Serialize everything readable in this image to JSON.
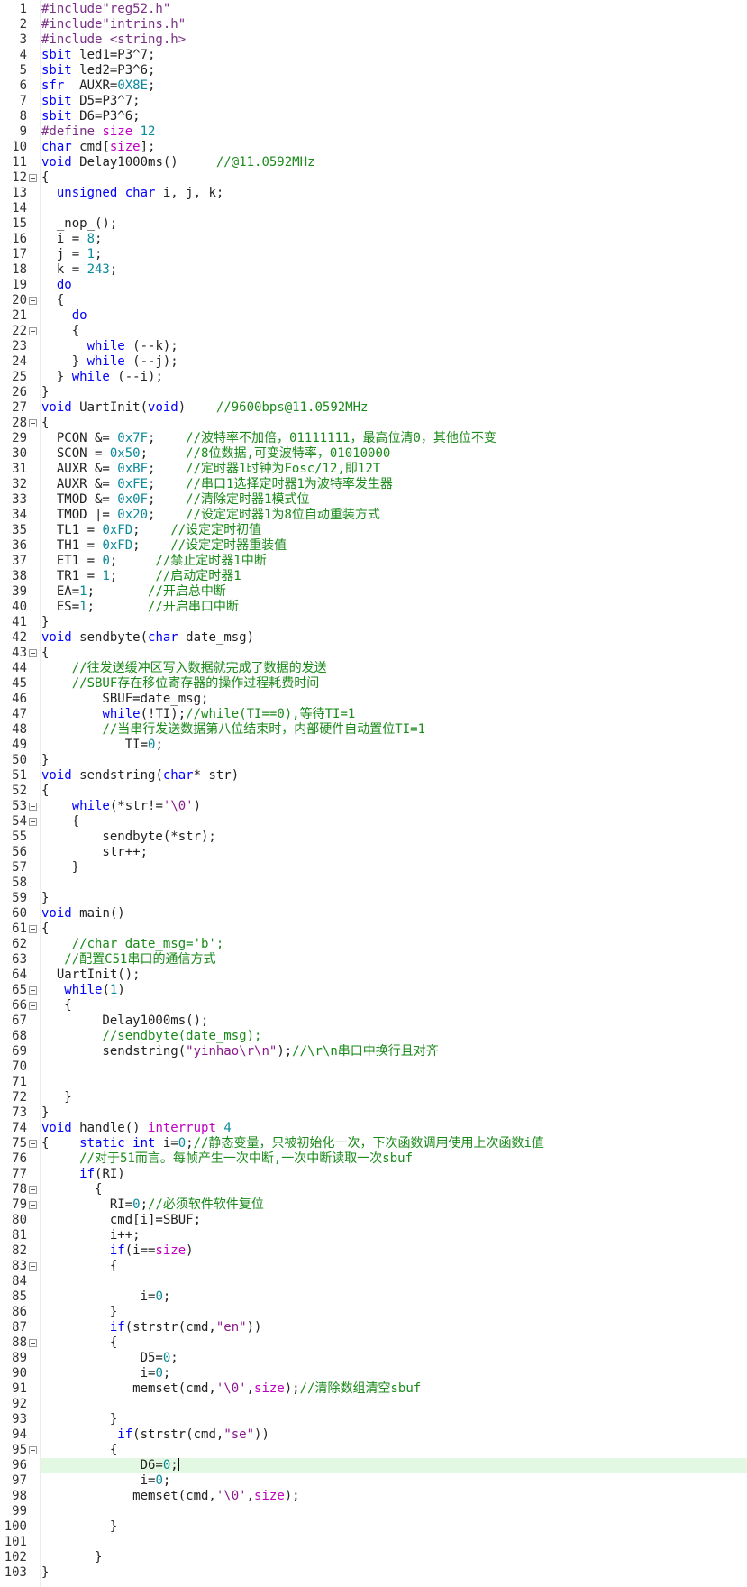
{
  "editor": {
    "current_line": 96,
    "folds": [
      12,
      20,
      22,
      28,
      43,
      53,
      54,
      61,
      65,
      66,
      75,
      78,
      79,
      83,
      88,
      95
    ],
    "lines": [
      [
        [
          "pp",
          "#include\"reg52.h\""
        ]
      ],
      [
        [
          "pp",
          "#include\"intrins.h\""
        ]
      ],
      [
        [
          "pp",
          "#include <string.h>"
        ]
      ],
      [
        [
          "kw",
          "sbit "
        ],
        [
          "id",
          "led1=P3^7;"
        ]
      ],
      [
        [
          "kw",
          "sbit "
        ],
        [
          "id",
          "led2=P3^6;"
        ]
      ],
      [
        [
          "kw",
          "sfr  "
        ],
        [
          "id",
          "AUXR="
        ],
        [
          "num",
          "0X8E"
        ],
        [
          "id",
          ";"
        ]
      ],
      [
        [
          "kw",
          "sbit "
        ],
        [
          "id",
          "D5=P3^7;"
        ]
      ],
      [
        [
          "kw",
          "sbit "
        ],
        [
          "id",
          "D6=P3^6;"
        ]
      ],
      [
        [
          "pp",
          "#define "
        ],
        [
          "ty",
          "size "
        ],
        [
          "num",
          "12"
        ]
      ],
      [
        [
          "kw",
          "char "
        ],
        [
          "id",
          "cmd["
        ],
        [
          "ty",
          "size"
        ],
        [
          "id",
          "];"
        ]
      ],
      [
        [
          "kw",
          "void "
        ],
        [
          "id",
          "Delay1000ms()     "
        ],
        [
          "cm",
          "//@11.0592MHz"
        ]
      ],
      [
        [
          "id",
          "{"
        ]
      ],
      [
        [
          "id",
          "  "
        ],
        [
          "kw",
          "unsigned char "
        ],
        [
          "id",
          "i, j, k;"
        ]
      ],
      [
        [
          "id",
          ""
        ]
      ],
      [
        [
          "id",
          "  _nop_();"
        ]
      ],
      [
        [
          "id",
          "  i = "
        ],
        [
          "num",
          "8"
        ],
        [
          "id",
          ";"
        ]
      ],
      [
        [
          "id",
          "  j = "
        ],
        [
          "num",
          "1"
        ],
        [
          "id",
          ";"
        ]
      ],
      [
        [
          "id",
          "  k = "
        ],
        [
          "num",
          "243"
        ],
        [
          "id",
          ";"
        ]
      ],
      [
        [
          "id",
          "  "
        ],
        [
          "kw",
          "do"
        ]
      ],
      [
        [
          "id",
          "  {"
        ]
      ],
      [
        [
          "id",
          "    "
        ],
        [
          "kw",
          "do"
        ]
      ],
      [
        [
          "id",
          "    {"
        ]
      ],
      [
        [
          "id",
          "      "
        ],
        [
          "kw",
          "while "
        ],
        [
          "id",
          "(--k);"
        ]
      ],
      [
        [
          "id",
          "    } "
        ],
        [
          "kw",
          "while "
        ],
        [
          "id",
          "(--j);"
        ]
      ],
      [
        [
          "id",
          "  } "
        ],
        [
          "kw",
          "while "
        ],
        [
          "id",
          "(--i);"
        ]
      ],
      [
        [
          "id",
          "}"
        ]
      ],
      [
        [
          "kw",
          "void "
        ],
        [
          "id",
          "UartInit("
        ],
        [
          "kw",
          "void"
        ],
        [
          "id",
          ")    "
        ],
        [
          "cm",
          "//9600bps@11.0592MHz"
        ]
      ],
      [
        [
          "id",
          "{"
        ]
      ],
      [
        [
          "id",
          "  PCON &= "
        ],
        [
          "num",
          "0x7F"
        ],
        [
          "id",
          ";    "
        ],
        [
          "cm",
          "//波特率不加倍，01111111，最高位清0，其他位不变"
        ]
      ],
      [
        [
          "id",
          "  SCON = "
        ],
        [
          "num",
          "0x50"
        ],
        [
          "id",
          ";     "
        ],
        [
          "cm",
          "//8位数据,可变波特率，01010000"
        ]
      ],
      [
        [
          "id",
          "  AUXR &= "
        ],
        [
          "num",
          "0xBF"
        ],
        [
          "id",
          ";    "
        ],
        [
          "cm",
          "//定时器1时钟为Fosc/12,即12T"
        ]
      ],
      [
        [
          "id",
          "  AUXR &= "
        ],
        [
          "num",
          "0xFE"
        ],
        [
          "id",
          ";    "
        ],
        [
          "cm",
          "//串口1选择定时器1为波特率发生器"
        ]
      ],
      [
        [
          "id",
          "  TMOD &= "
        ],
        [
          "num",
          "0x0F"
        ],
        [
          "id",
          ";    "
        ],
        [
          "cm",
          "//清除定时器1模式位"
        ]
      ],
      [
        [
          "id",
          "  TMOD |= "
        ],
        [
          "num",
          "0x20"
        ],
        [
          "id",
          ";    "
        ],
        [
          "cm",
          "//设定定时器1为8位自动重装方式"
        ]
      ],
      [
        [
          "id",
          "  TL1 = "
        ],
        [
          "num",
          "0xFD"
        ],
        [
          "id",
          ";    "
        ],
        [
          "cm",
          "//设定定时初值"
        ]
      ],
      [
        [
          "id",
          "  TH1 = "
        ],
        [
          "num",
          "0xFD"
        ],
        [
          "id",
          ";    "
        ],
        [
          "cm",
          "//设定定时器重装值"
        ]
      ],
      [
        [
          "id",
          "  ET1 = "
        ],
        [
          "num",
          "0"
        ],
        [
          "id",
          ";     "
        ],
        [
          "cm",
          "//禁止定时器1中断"
        ]
      ],
      [
        [
          "id",
          "  TR1 = "
        ],
        [
          "num",
          "1"
        ],
        [
          "id",
          ";     "
        ],
        [
          "cm",
          "//启动定时器1"
        ]
      ],
      [
        [
          "id",
          "  EA="
        ],
        [
          "num",
          "1"
        ],
        [
          "id",
          ";       "
        ],
        [
          "cm",
          "//开启总中断"
        ]
      ],
      [
        [
          "id",
          "  ES="
        ],
        [
          "num",
          "1"
        ],
        [
          "id",
          ";       "
        ],
        [
          "cm",
          "//开启串口中断"
        ]
      ],
      [
        [
          "id",
          "}"
        ]
      ],
      [
        [
          "kw",
          "void "
        ],
        [
          "id",
          "sendbyte("
        ],
        [
          "kw",
          "char "
        ],
        [
          "id",
          "date_msg)"
        ]
      ],
      [
        [
          "id",
          "{"
        ]
      ],
      [
        [
          "id",
          "    "
        ],
        [
          "cm",
          "//往发送缓冲区写入数据就完成了数据的发送"
        ]
      ],
      [
        [
          "id",
          "    "
        ],
        [
          "cm",
          "//SBUF存在移位寄存器的操作过程耗费时间"
        ]
      ],
      [
        [
          "id",
          "        SBUF=date_msg;"
        ]
      ],
      [
        [
          "id",
          "        "
        ],
        [
          "kw",
          "while"
        ],
        [
          "id",
          "(!TI);"
        ],
        [
          "cm",
          "//while(TI==0),等待TI=1"
        ]
      ],
      [
        [
          "id",
          "        "
        ],
        [
          "cm",
          "//当串行发送数据第八位结束时，内部硬件自动置位TI=1"
        ]
      ],
      [
        [
          "id",
          "           TI="
        ],
        [
          "num",
          "0"
        ],
        [
          "id",
          ";"
        ]
      ],
      [
        [
          "id",
          "}"
        ]
      ],
      [
        [
          "kw",
          "void "
        ],
        [
          "id",
          "sendstring("
        ],
        [
          "kw",
          "char"
        ],
        [
          "id",
          "* str)"
        ]
      ],
      [
        [
          "id",
          "{"
        ]
      ],
      [
        [
          "id",
          "    "
        ],
        [
          "kw",
          "while"
        ],
        [
          "id",
          "(*str!="
        ],
        [
          "str",
          "'\\0'"
        ],
        [
          "id",
          ")"
        ]
      ],
      [
        [
          "id",
          "    {"
        ]
      ],
      [
        [
          "id",
          "        sendbyte(*str);"
        ]
      ],
      [
        [
          "id",
          "        str++;"
        ]
      ],
      [
        [
          "id",
          "    }"
        ]
      ],
      [
        [
          "id",
          ""
        ]
      ],
      [
        [
          "id",
          "}"
        ]
      ],
      [
        [
          "kw",
          "void "
        ],
        [
          "id",
          "main()"
        ]
      ],
      [
        [
          "id",
          "{"
        ]
      ],
      [
        [
          "id",
          "    "
        ],
        [
          "cm",
          "//char date_msg='b';"
        ]
      ],
      [
        [
          "id",
          "   "
        ],
        [
          "cm",
          "//配置C51串口的通信方式"
        ]
      ],
      [
        [
          "id",
          "  UartInit();"
        ]
      ],
      [
        [
          "id",
          "   "
        ],
        [
          "kw",
          "while"
        ],
        [
          "id",
          "("
        ],
        [
          "num",
          "1"
        ],
        [
          "id",
          ")"
        ]
      ],
      [
        [
          "id",
          "   {"
        ]
      ],
      [
        [
          "id",
          "        Delay1000ms();"
        ]
      ],
      [
        [
          "id",
          "        "
        ],
        [
          "cm",
          "//sendbyte(date_msg);"
        ]
      ],
      [
        [
          "id",
          "        sendstring("
        ],
        [
          "str",
          "\"yinhao\\r\\n\""
        ],
        [
          "id",
          ");"
        ],
        [
          "cm",
          "//\\r\\n串口中换行且对齐"
        ]
      ],
      [
        [
          "id",
          ""
        ]
      ],
      [
        [
          "id",
          ""
        ]
      ],
      [
        [
          "id",
          "   }"
        ]
      ],
      [
        [
          "id",
          "}"
        ]
      ],
      [
        [
          "kw",
          "void "
        ],
        [
          "id",
          "handle() "
        ],
        [
          "ty",
          "interrupt "
        ],
        [
          "num",
          "4"
        ]
      ],
      [
        [
          "id",
          "{    "
        ],
        [
          "kw",
          "static int "
        ],
        [
          "id",
          "i="
        ],
        [
          "num",
          "0"
        ],
        [
          "id",
          ";"
        ],
        [
          "cm",
          "//静态变量，只被初始化一次，下次函数调用使用上次函数i值"
        ]
      ],
      [
        [
          "id",
          "     "
        ],
        [
          "cm",
          "//对于51而言。每帧产生一次中断,一次中断读取一次sbuf"
        ]
      ],
      [
        [
          "id",
          "     "
        ],
        [
          "kw",
          "if"
        ],
        [
          "id",
          "(RI)"
        ]
      ],
      [
        [
          "id",
          "       {"
        ]
      ],
      [
        [
          "id",
          "         RI="
        ],
        [
          "num",
          "0"
        ],
        [
          "id",
          ";"
        ],
        [
          "cm",
          "//必须软件软件复位"
        ]
      ],
      [
        [
          "id",
          "         cmd[i]=SBUF;"
        ]
      ],
      [
        [
          "id",
          "         i++;"
        ]
      ],
      [
        [
          "id",
          "         "
        ],
        [
          "kw",
          "if"
        ],
        [
          "id",
          "(i=="
        ],
        [
          "ty",
          "size"
        ],
        [
          "id",
          ")"
        ]
      ],
      [
        [
          "id",
          "         {"
        ]
      ],
      [
        [
          "id",
          ""
        ]
      ],
      [
        [
          "id",
          "             i="
        ],
        [
          "num",
          "0"
        ],
        [
          "id",
          ";"
        ]
      ],
      [
        [
          "id",
          "         }"
        ]
      ],
      [
        [
          "id",
          "         "
        ],
        [
          "kw",
          "if"
        ],
        [
          "id",
          "(strstr(cmd,"
        ],
        [
          "str",
          "\"en\""
        ],
        [
          "id",
          "))"
        ]
      ],
      [
        [
          "id",
          "         {"
        ]
      ],
      [
        [
          "id",
          "             D5="
        ],
        [
          "num",
          "0"
        ],
        [
          "id",
          ";"
        ]
      ],
      [
        [
          "id",
          "             i="
        ],
        [
          "num",
          "0"
        ],
        [
          "id",
          ";"
        ]
      ],
      [
        [
          "id",
          "            memset(cmd,"
        ],
        [
          "str",
          "'\\0'"
        ],
        [
          "id",
          ","
        ],
        [
          "ty",
          "size"
        ],
        [
          "id",
          ");"
        ],
        [
          "cm",
          "//清除数组清空sbuf"
        ]
      ],
      [
        [
          "id",
          ""
        ]
      ],
      [
        [
          "id",
          "         }"
        ]
      ],
      [
        [
          "id",
          "          "
        ],
        [
          "kw",
          "if"
        ],
        [
          "id",
          "(strstr(cmd,"
        ],
        [
          "str",
          "\"se\""
        ],
        [
          "id",
          "))"
        ]
      ],
      [
        [
          "id",
          "         {"
        ]
      ],
      [
        [
          "id",
          "             D6="
        ],
        [
          "num",
          "0"
        ],
        [
          "id",
          ";"
        ],
        [
          "caret",
          ""
        ]
      ],
      [
        [
          "id",
          "             i="
        ],
        [
          "num",
          "0"
        ],
        [
          "id",
          ";"
        ]
      ],
      [
        [
          "id",
          "            memset(cmd,"
        ],
        [
          "str",
          "'\\0'"
        ],
        [
          "id",
          ","
        ],
        [
          "ty",
          "size"
        ],
        [
          "id",
          ");"
        ]
      ],
      [
        [
          "id",
          ""
        ]
      ],
      [
        [
          "id",
          "         }"
        ]
      ],
      [
        [
          "id",
          ""
        ]
      ],
      [
        [
          "id",
          "       }"
        ]
      ],
      [
        [
          "id",
          "}"
        ]
      ]
    ]
  }
}
